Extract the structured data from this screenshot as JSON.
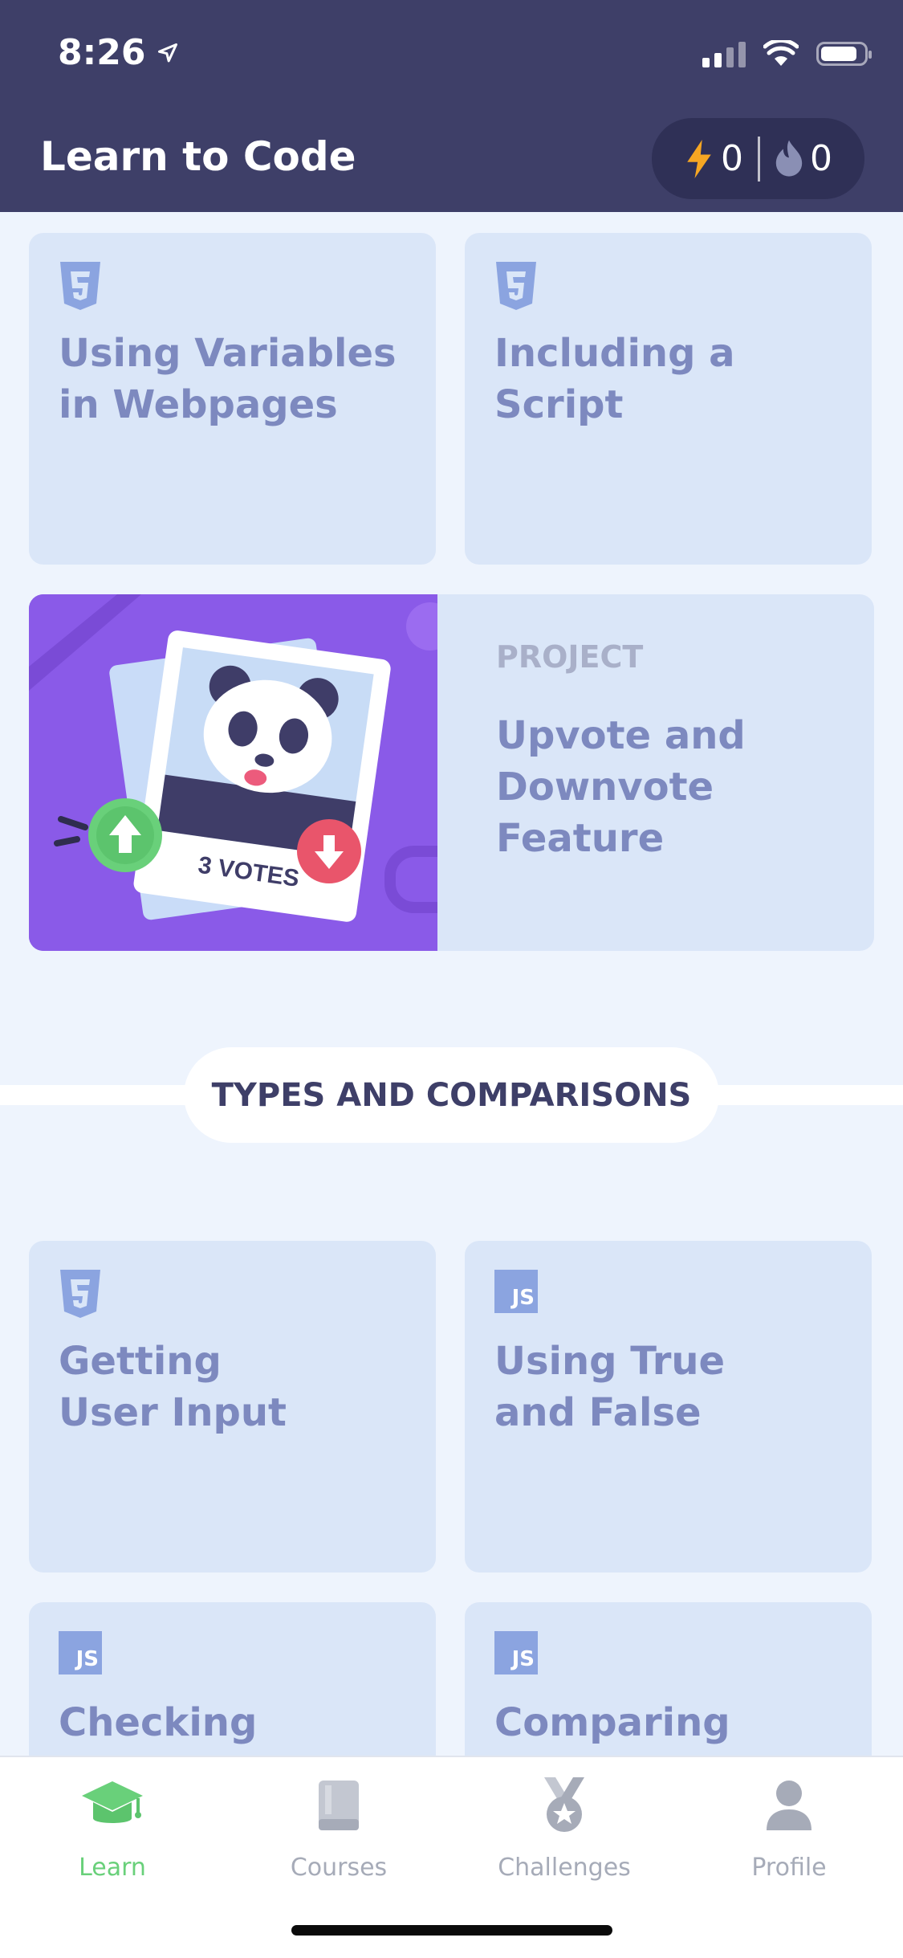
{
  "status_bar": {
    "time": "8:26"
  },
  "header": {
    "title": "Learn to Code",
    "energy_count": "0",
    "streak_count": "0"
  },
  "cards_top": [
    {
      "badge": "html5",
      "title": "Using Variables\nin Webpages"
    },
    {
      "badge": "html5",
      "title": "Including a Script"
    }
  ],
  "project": {
    "tag": "PROJECT",
    "title": "Upvote and\nDownvote\nFeature",
    "image_text": "3 VOTES"
  },
  "section": {
    "title": "TYPES AND COMPARISONS"
  },
  "cards_bottom": [
    {
      "badge": "html5",
      "title": "Getting\nUser Input"
    },
    {
      "badge": "JS",
      "title": "Using True\nand False"
    },
    {
      "badge": "JS",
      "title": "Checking"
    },
    {
      "badge": "JS",
      "title": "Comparing"
    }
  ],
  "tabbar": {
    "items": [
      {
        "label": "Learn",
        "icon": "graduation-cap-icon",
        "active": true
      },
      {
        "label": "Courses",
        "icon": "book-icon",
        "active": false
      },
      {
        "label": "Challenges",
        "icon": "medal-icon",
        "active": false
      },
      {
        "label": "Profile",
        "icon": "person-icon",
        "active": false
      }
    ]
  },
  "colors": {
    "header_bg": "#3e3f68",
    "card_bg": "#dae6f8",
    "card_text": "#7d89bf",
    "project_art_bg": "#8a5ae8",
    "active_tab": "#69d07a"
  }
}
